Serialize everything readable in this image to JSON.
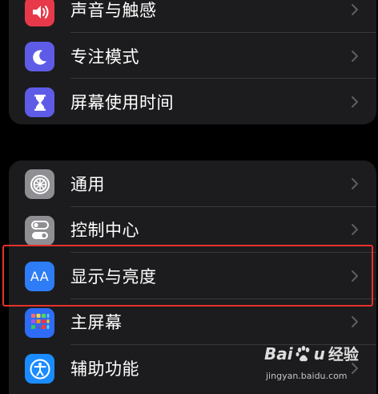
{
  "colors": {
    "background": "#000000",
    "group_background": "#1c1c1e",
    "separator": "#38383a",
    "chevron": "#5e5e62",
    "highlight_border": "#e5312c"
  },
  "group1": {
    "items": [
      {
        "label": "声音与触感",
        "icon": "speaker-icon",
        "icon_bg": "#e8394a"
      },
      {
        "label": "专注模式",
        "icon": "moon-icon",
        "icon_bg": "#5e5ce6"
      },
      {
        "label": "屏幕使用时间",
        "icon": "hourglass-icon",
        "icon_bg": "#5e5ce6"
      }
    ]
  },
  "group2": {
    "items": [
      {
        "label": "通用",
        "icon": "gear-icon",
        "icon_bg": "#8e8e93"
      },
      {
        "label": "控制中心",
        "icon": "toggles-icon",
        "icon_bg": "#8e8e93"
      },
      {
        "label": "显示与亮度",
        "icon": "text-size-icon",
        "icon_bg": "#2e7cf6",
        "icon_text": "AA"
      },
      {
        "label": "主屏幕",
        "icon": "home-grid-icon",
        "icon_bg": "#2e6cf6"
      },
      {
        "label": "辅助功能",
        "icon": "accessibility-icon",
        "icon_bg": "#1a8cff"
      }
    ]
  },
  "watermark": {
    "brand_left": "Bai",
    "brand_right": "u",
    "brand_suffix": "经验",
    "url": "jingyan.baidu.com"
  }
}
